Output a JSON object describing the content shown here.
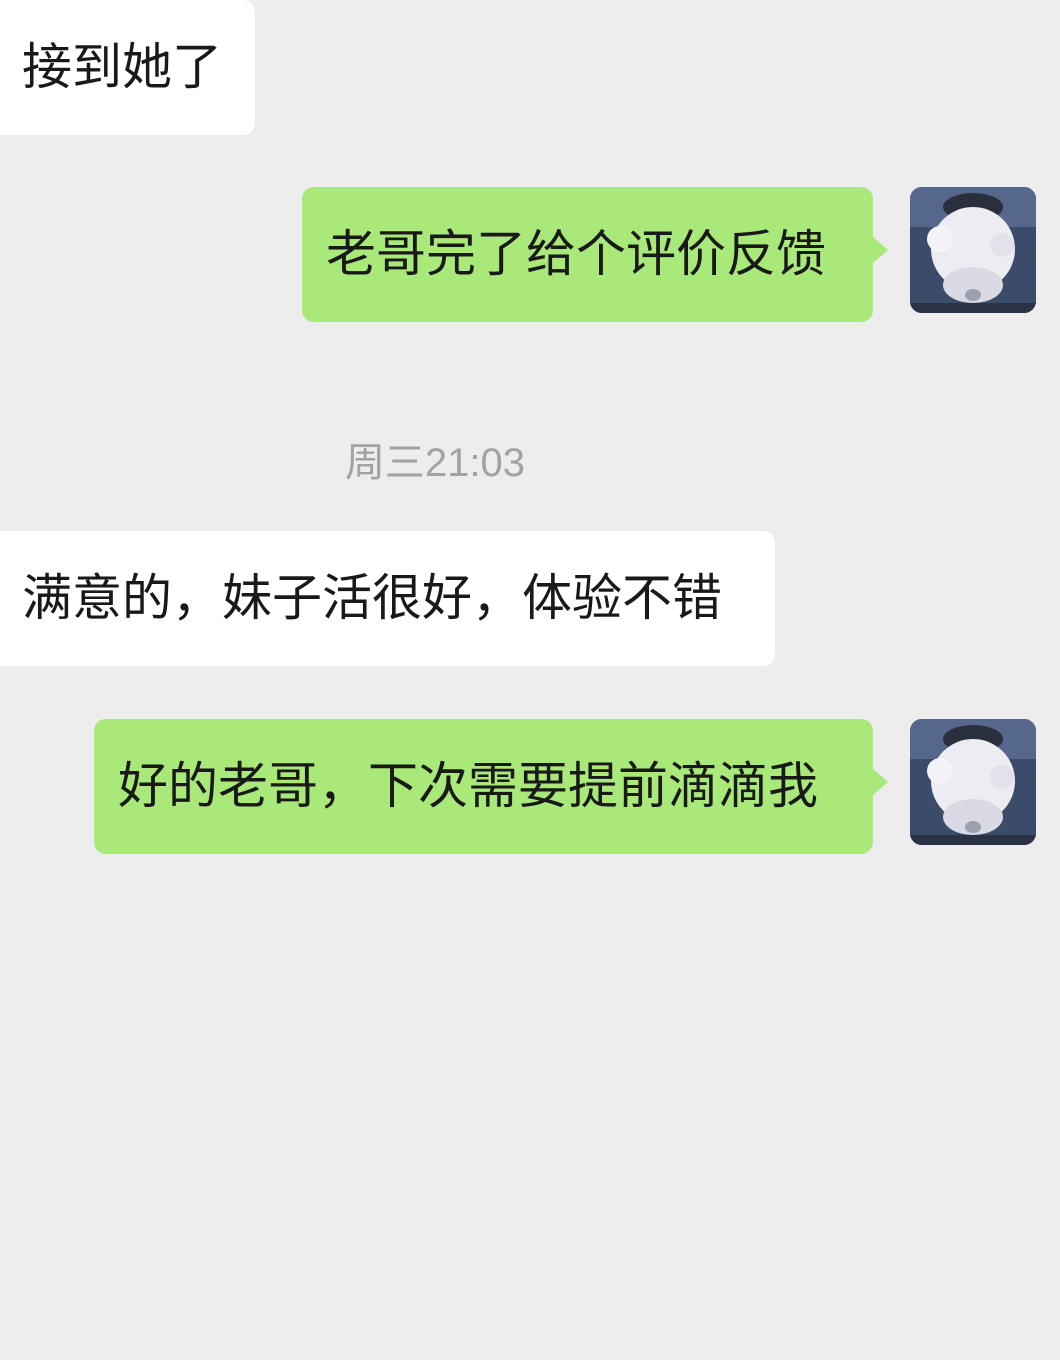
{
  "chat": {
    "timestamp": "周三21:03",
    "messages": [
      {
        "from": "contact",
        "text": "接到她了"
      },
      {
        "from": "me",
        "text": "老哥完了给个评价反馈",
        "avatar": "snowman-avatar"
      },
      {
        "from": "contact",
        "text": "满意的，妹子活很好，体验不错"
      },
      {
        "from": "me",
        "text": "好的老哥，下次需要提前滴滴我",
        "avatar": "snowman-avatar"
      }
    ]
  },
  "colors": {
    "background": "#ededed",
    "incoming_bubble": "#ffffff",
    "outgoing_bubble": "#a9e97a",
    "message_text": "#191919",
    "timestamp_text": "#a2a2a2"
  }
}
